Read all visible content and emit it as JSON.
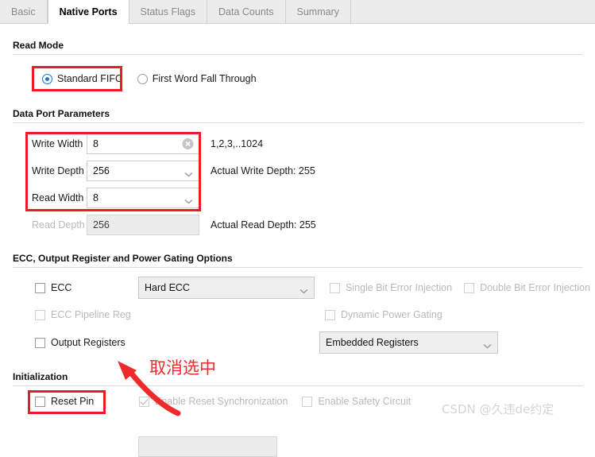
{
  "tabs": [
    {
      "label": "Basic",
      "active": false
    },
    {
      "label": "Native Ports",
      "active": true
    },
    {
      "label": "Status Flags",
      "active": false
    },
    {
      "label": "Data Counts",
      "active": false
    },
    {
      "label": "Summary",
      "active": false
    }
  ],
  "read_mode": {
    "title": "Read Mode",
    "options": [
      {
        "label": "Standard FIFO",
        "selected": true
      },
      {
        "label": "First Word Fall Through",
        "selected": false
      }
    ]
  },
  "data_port": {
    "title": "Data Port Parameters",
    "write_width": {
      "label": "Write Width",
      "value": "8",
      "hint": "1,2,3,..1024",
      "clear_icon": "clear-circle-icon"
    },
    "write_depth": {
      "label": "Write Depth",
      "value": "256",
      "hint": "Actual Write Depth: 255"
    },
    "read_width": {
      "label": "Read Width",
      "value": "8",
      "hint": ""
    },
    "read_depth": {
      "label": "Read Depth",
      "value": "256",
      "hint": "Actual Read Depth: 255",
      "disabled": true
    }
  },
  "ecc": {
    "title": "ECC, Output Register and Power Gating Options",
    "ecc_checkbox": "ECC",
    "ecc_mode_value": "Hard ECC",
    "single_bit": "Single Bit Error Injection",
    "double_bit": "Double Bit Error Injection",
    "ecc_pipeline_reg": "ECC Pipeline Reg",
    "dynamic_power_gating": "Dynamic Power Gating",
    "output_registers": "Output Registers",
    "output_register_value": "Embedded Registers"
  },
  "initialization": {
    "title": "Initialization",
    "reset_pin": "Reset Pin",
    "enable_reset_sync": "Enable Reset Synchronization",
    "enable_safety_circuit": "Enable Safety Circuit"
  },
  "annotations": {
    "note_text": "取消选中",
    "watermark": "CSDN @久违de约定",
    "highlight_color": "#ec1c24"
  }
}
